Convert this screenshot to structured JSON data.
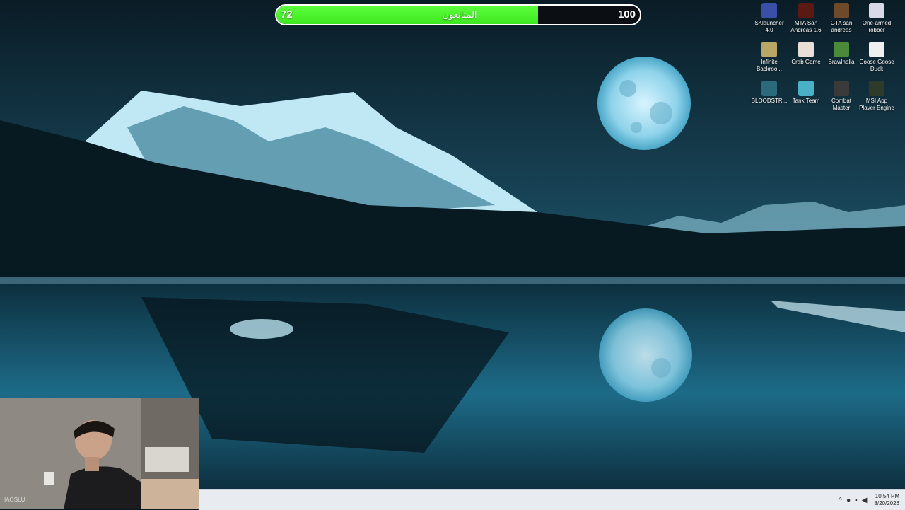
{
  "goal": {
    "label": "المتابعون",
    "current": "72",
    "target": "100",
    "progress": 0.72,
    "fill_color": "#3ee820"
  },
  "desktop_icons": [
    {
      "label": "SKlauncher 4.0",
      "icon": "sklauncher-icon",
      "color": "#3a4fa8"
    },
    {
      "label": "MTA San Andreas 1.6",
      "icon": "mta-icon",
      "color": "#5a1a14"
    },
    {
      "label": "GTA san andreas",
      "icon": "gta-icon",
      "color": "#6e4a2a"
    },
    {
      "label": "One-armed robber",
      "icon": "robber-icon",
      "color": "#d8d8e8"
    },
    {
      "label": "Infinite Backroo...",
      "icon": "backrooms-icon",
      "color": "#b9a766"
    },
    {
      "label": "Crab Game",
      "icon": "crab-game-icon",
      "color": "#e8e0d8"
    },
    {
      "label": "Brawlhalla",
      "icon": "brawlhalla-icon",
      "color": "#4a8a3a"
    },
    {
      "label": "Goose Goose Duck",
      "icon": "goose-duck-icon",
      "color": "#f0f0f0"
    },
    {
      "label": "BLOODSTR...",
      "icon": "bloodstrike-icon",
      "color": "#2a6a7a"
    },
    {
      "label": "Tank Team",
      "icon": "tank-team-icon",
      "color": "#4ab0c8"
    },
    {
      "label": "Combat Master",
      "icon": "combat-master-icon",
      "color": "#3a3a3a"
    },
    {
      "label": "MSI App Player Engine",
      "icon": "msi-player-icon",
      "color": "#2e3a2a"
    }
  ],
  "webcam": {
    "brand": "IAOSLU"
  },
  "taskbar": {
    "time": "10:54 PM",
    "date": "8/20/2026"
  }
}
